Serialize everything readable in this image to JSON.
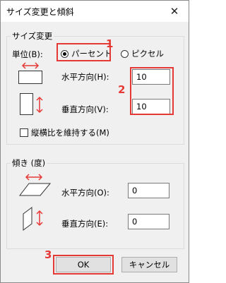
{
  "window": {
    "title": "サイズ変更と傾斜",
    "close_symbol": "✕"
  },
  "resize": {
    "legend": "サイズ変更",
    "unit_label": "単位(B):",
    "unit_options": [
      {
        "label": "パーセント",
        "selected": true
      },
      {
        "label": "ピクセル",
        "selected": false
      }
    ],
    "horizontal_label": "水平方向(H):",
    "horizontal_value": "10",
    "vertical_label": "垂直方向(V):",
    "vertical_value": "10",
    "keep_ratio_label": "縦横比を維持する(M)",
    "keep_ratio_checked": false
  },
  "skew": {
    "legend": "傾き (度)",
    "horizontal_label": "水平方向(O):",
    "horizontal_value": "0",
    "vertical_label": "垂直方向(E):",
    "vertical_value": "0"
  },
  "buttons": {
    "ok": "OK",
    "cancel": "キャンセル"
  },
  "annotations": {
    "n1": "1",
    "n2": "2",
    "n3": "3"
  },
  "colors": {
    "highlight": "#e53935",
    "arrow": "#e53935"
  }
}
